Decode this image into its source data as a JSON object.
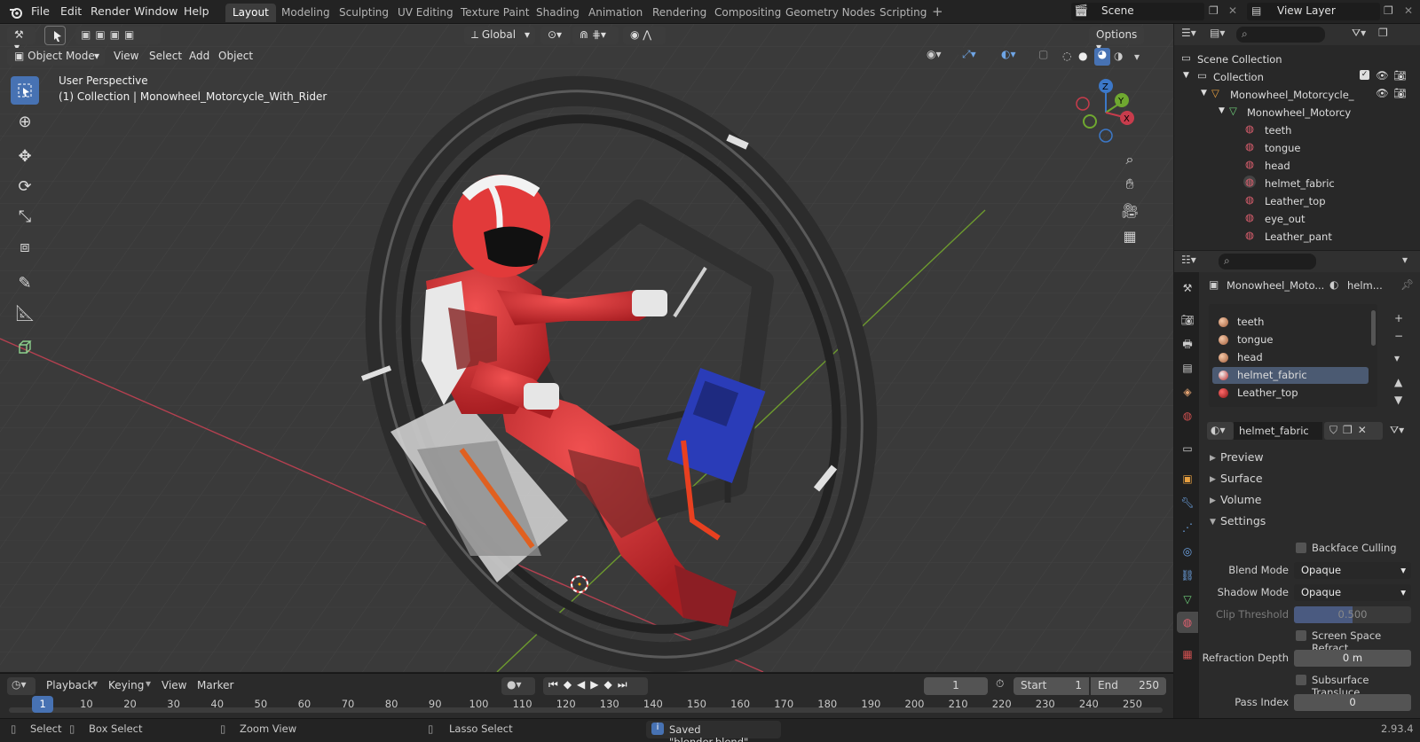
{
  "menus": [
    "File",
    "Edit",
    "Render",
    "Window",
    "Help"
  ],
  "workspaces": [
    "Layout",
    "Modeling",
    "Sculpting",
    "UV Editing",
    "Texture Paint",
    "Shading",
    "Animation",
    "Rendering",
    "Compositing",
    "Geometry Nodes",
    "Scripting"
  ],
  "active_workspace": "Layout",
  "scene": "Scene",
  "view_layer": "View Layer",
  "viewport": {
    "mode": "Object Mode",
    "menus": [
      "View",
      "Select",
      "Add",
      "Object"
    ],
    "orientation": "Global",
    "options": "Options",
    "perspective_label": "User Perspective",
    "collection_label": "(1) Collection | Monowheel_Motorcycle_With_Rider"
  },
  "outliner": {
    "scene_collection": "Scene Collection",
    "collection": "Collection",
    "object": "Monowheel_Motorcycle_",
    "mesh": "Monowheel_Motorcy",
    "materials": [
      "teeth",
      "tongue",
      "head",
      "helmet_fabric",
      "Leather_top",
      "eye_out",
      "Leather_pant"
    ]
  },
  "properties": {
    "object_name": "Monowheel_Moto...",
    "material_short": "helm...",
    "slots": [
      "teeth",
      "tongue",
      "head",
      "helmet_fabric",
      "Leather_top"
    ],
    "selected_slot": "helmet_fabric",
    "active_material": "helmet_fabric",
    "panels": [
      "Preview",
      "Surface",
      "Volume",
      "Settings"
    ],
    "settings": {
      "backface_culling": "Backface Culling",
      "blend_mode_label": "Blend Mode",
      "blend_mode": "Opaque",
      "shadow_mode_label": "Shadow Mode",
      "shadow_mode": "Opaque",
      "clip_threshold_label": "Clip Threshold",
      "clip_threshold": "0.500",
      "ssr_label": "Screen Space Refract...",
      "refraction_depth_label": "Refraction Depth",
      "refraction_depth": "0 m",
      "sss_label": "Subsurface Transluce...",
      "pass_index_label": "Pass Index",
      "pass_index": "0"
    }
  },
  "timeline": {
    "menus": [
      "Playback",
      "Keying",
      "View",
      "Marker"
    ],
    "current_frame": "1",
    "start_label": "Start",
    "start": "1",
    "end_label": "End",
    "end": "250",
    "ticks": [
      "1",
      "10",
      "20",
      "30",
      "40",
      "50",
      "60",
      "70",
      "80",
      "90",
      "100",
      "110",
      "120",
      "130",
      "140",
      "150",
      "160",
      "170",
      "180",
      "190",
      "200",
      "210",
      "220",
      "230",
      "240",
      "250"
    ]
  },
  "status": {
    "select": "Select",
    "box_select": "Box Select",
    "zoom_view": "Zoom View",
    "lasso_select": "Lasso Select",
    "message": "Saved \"blender.blend\"",
    "version": "2.93.4"
  },
  "colors": {
    "accent": "#4772b3",
    "x_axis": "#c83c4c",
    "y_axis": "#6fa830",
    "z_axis": "#3c78c8"
  }
}
